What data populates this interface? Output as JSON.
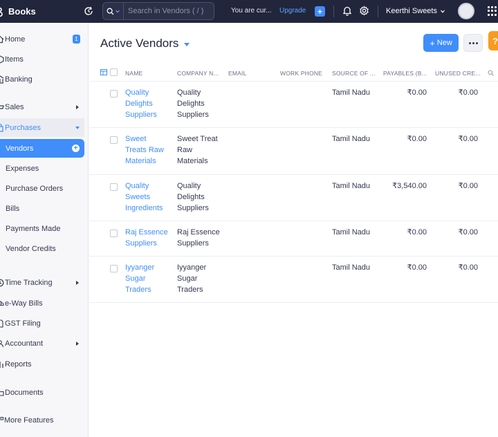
{
  "topbar": {
    "brand": "Books",
    "search_placeholder": "Search in Vendors ( / )",
    "trial_text": "You are cur...",
    "upgrade_label": "Upgrade",
    "org_name": "Keerthi Sweets",
    "accent_color": "#408dfb",
    "bar_color": "#21263c"
  },
  "sidebar": {
    "items": [
      {
        "label": "Home",
        "badge": "1"
      },
      {
        "label": "Items"
      },
      {
        "label": "Banking"
      },
      {
        "label": "Sales"
      },
      {
        "label": "Purchases"
      },
      {
        "label": "Vendors"
      },
      {
        "label": "Expenses"
      },
      {
        "label": "Purchase Orders"
      },
      {
        "label": "Bills"
      },
      {
        "label": "Payments Made"
      },
      {
        "label": "Vendor Credits"
      },
      {
        "label": "Time Tracking"
      },
      {
        "label": "e-Way Bills"
      },
      {
        "label": "GST Filing"
      },
      {
        "label": "Accountant"
      },
      {
        "label": "Reports"
      },
      {
        "label": "Documents"
      },
      {
        "label": "More Features"
      }
    ]
  },
  "main": {
    "title": "Active Vendors",
    "new_label": "New",
    "help_label": "?",
    "columns": [
      "NAME",
      "COMPANY N...",
      "EMAIL",
      "WORK PHONE",
      "SOURCE OF ...",
      "PAYABLES (B...",
      "UNUSED CRE..."
    ],
    "rows": [
      {
        "name": "Quality Delights Suppliers",
        "company": "Quality Delights Suppliers",
        "email": "",
        "phone": "",
        "source": "Tamil Nadu",
        "payables": "₹0.00",
        "unused": "₹0.00"
      },
      {
        "name": "Sweet Treats Raw Materials",
        "company": "Sweet Treat Raw Materials",
        "email": "",
        "phone": "",
        "source": "Tamil Nadu",
        "payables": "₹0.00",
        "unused": "₹0.00"
      },
      {
        "name": "Quality Sweets Ingredients",
        "company": "Quality Delights Suppliers",
        "email": "",
        "phone": "",
        "source": "Tamil Nadu",
        "payables": "₹3,540.00",
        "unused": "₹0.00"
      },
      {
        "name": "Raj Essence Suppliers",
        "company": "Raj Essence Suppliers",
        "email": "",
        "phone": "",
        "source": "Tamil Nadu",
        "payables": "₹0.00",
        "unused": "₹0.00"
      },
      {
        "name": "Iyyanger Sugar Traders",
        "company": "Iyyanger Sugar Traders",
        "email": "",
        "phone": "",
        "source": "Tamil Nadu",
        "payables": "₹0.00",
        "unused": "₹0.00"
      }
    ]
  }
}
